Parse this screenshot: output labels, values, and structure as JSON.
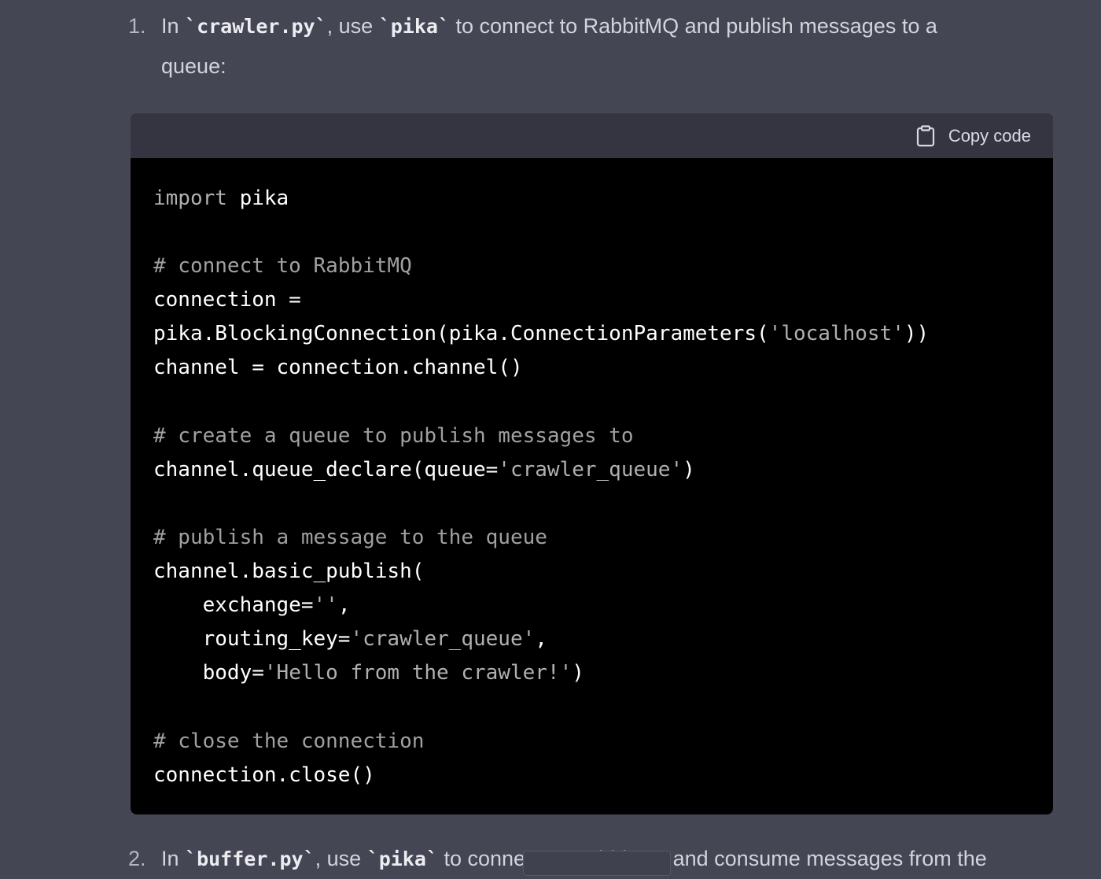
{
  "step1": {
    "number": "1.",
    "text_before": "In ",
    "code_file": "`crawler.py`",
    "text_mid": ", use ",
    "code_lib": "`pika`",
    "text_after": " to connect to RabbitMQ and publish messages to a queue:"
  },
  "code_block": {
    "copy_label": "Copy code",
    "icon": "clipboard-icon",
    "lines": [
      [
        {
          "t": "import",
          "c": "kw"
        },
        {
          "t": " pika",
          "c": "pl"
        }
      ],
      [],
      [
        {
          "t": "# connect to RabbitMQ",
          "c": "cm"
        }
      ],
      [
        {
          "t": "connection =",
          "c": "pl"
        }
      ],
      [
        {
          "t": "pika.BlockingConnection(pika.ConnectionParameters(",
          "c": "pl"
        },
        {
          "t": "'localhost'",
          "c": "str"
        },
        {
          "t": "))",
          "c": "pl"
        }
      ],
      [
        {
          "t": "channel = connection.channel()",
          "c": "pl"
        }
      ],
      [],
      [
        {
          "t": "# create a queue to publish messages to",
          "c": "cm"
        }
      ],
      [
        {
          "t": "channel.queue_declare(queue=",
          "c": "pl"
        },
        {
          "t": "'crawler_queue'",
          "c": "str"
        },
        {
          "t": ")",
          "c": "pl"
        }
      ],
      [],
      [
        {
          "t": "# publish a message to the queue",
          "c": "cm"
        }
      ],
      [
        {
          "t": "channel.basic_publish(",
          "c": "pl"
        }
      ],
      [
        {
          "t": "    exchange=",
          "c": "pl"
        },
        {
          "t": "''",
          "c": "str"
        },
        {
          "t": ",",
          "c": "pl"
        }
      ],
      [
        {
          "t": "    routing_key=",
          "c": "pl"
        },
        {
          "t": "'crawler_queue'",
          "c": "str"
        },
        {
          "t": ",",
          "c": "pl"
        }
      ],
      [
        {
          "t": "    body=",
          "c": "pl"
        },
        {
          "t": "'Hello from the crawler!'",
          "c": "str"
        },
        {
          "t": ")",
          "c": "pl"
        }
      ],
      [],
      [
        {
          "t": "# close the connection",
          "c": "cm"
        }
      ],
      [
        {
          "t": "connection.close()",
          "c": "pl"
        }
      ]
    ]
  },
  "step2": {
    "number": "2.",
    "text_before": "In ",
    "code_file": "`buffer.py`",
    "text_mid": ", use ",
    "code_lib": "`pika`",
    "text_after": " to connect to RabbitMQ and consume messages from the"
  },
  "colors": {
    "page_bg": "#444654",
    "code_bg": "#000000",
    "code_header_bg": "#343541"
  }
}
